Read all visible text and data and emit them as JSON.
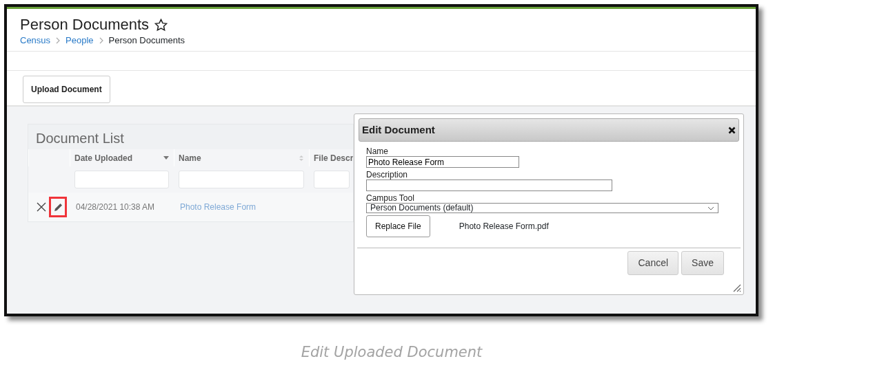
{
  "header": {
    "title": "Person Documents",
    "favorite": false,
    "breadcrumb": [
      {
        "label": "Census",
        "link": true
      },
      {
        "label": "People",
        "link": true
      },
      {
        "label": "Person Documents",
        "link": false
      }
    ]
  },
  "toolbar": {
    "buttons": [
      "Upload Document"
    ]
  },
  "document_list": {
    "title": "Document List",
    "columns": [
      {
        "label": "Date Uploaded",
        "kind": "sorted"
      },
      {
        "label": "Name",
        "kind": "sortable"
      },
      {
        "label": "File Descr",
        "kind": "plain"
      }
    ],
    "rows": [
      {
        "edit_highlighted": true,
        "date_uploaded": "04/28/2021 10:38 AM",
        "name": "Photo Release Form"
      }
    ]
  },
  "dialog": {
    "title": "Edit Document",
    "fields": [
      {
        "kind": "text",
        "label": "Name",
        "value": "Photo Release Form"
      },
      {
        "kind": "text",
        "label": "Description"
      },
      {
        "kind": "select",
        "label": "Campus Tool",
        "value": "Person Documents (default)"
      }
    ],
    "replace_button": "Replace File",
    "file_name": "Photo Release Form.pdf",
    "buttons": [
      "Cancel",
      "Save"
    ]
  },
  "caption": "Edit Uploaded Document"
}
